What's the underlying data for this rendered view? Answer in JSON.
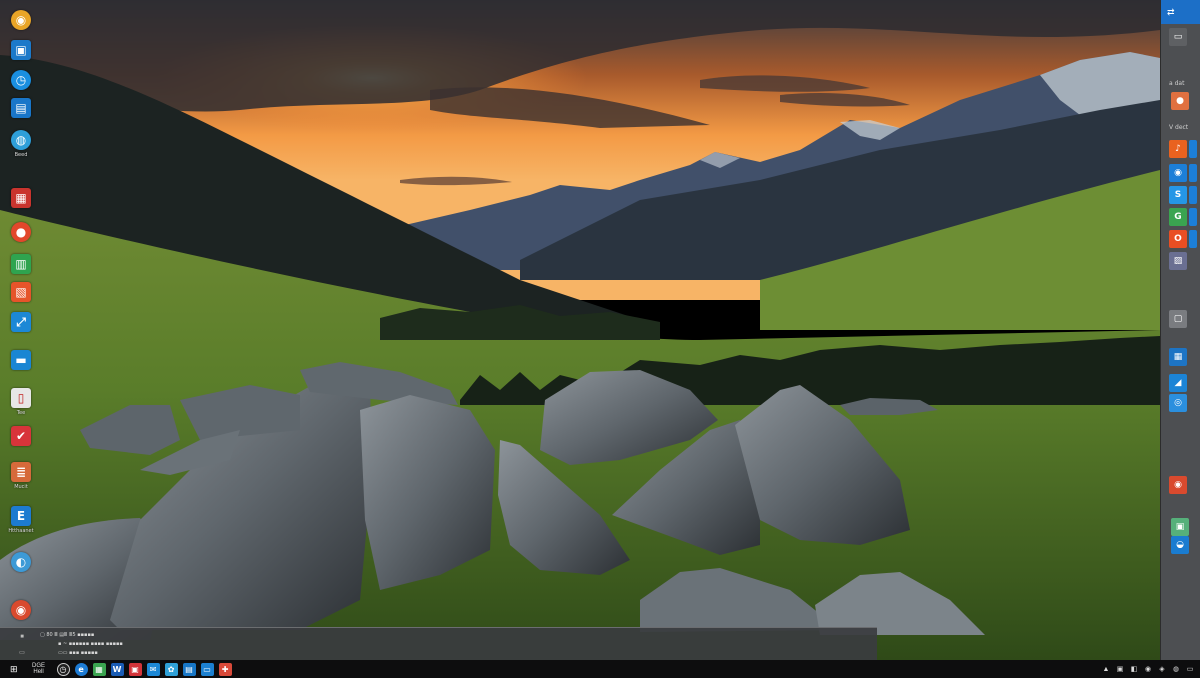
{
  "desktop_icons": [
    {
      "name": "chrome-icon",
      "glyph": "◉",
      "color": "#e9a527",
      "round": true,
      "label": ""
    },
    {
      "name": "app-blue-icon",
      "glyph": "▣",
      "color": "#1c79c9",
      "round": false,
      "label": ""
    },
    {
      "name": "clock-icon",
      "glyph": "◷",
      "color": "#1a8fe0",
      "round": true,
      "label": ""
    },
    {
      "name": "app-square-icon",
      "glyph": "▤",
      "color": "#1976c9",
      "round": false,
      "label": ""
    },
    {
      "name": "browser-icon",
      "glyph": "◍",
      "color": "#2e9fd9",
      "round": true,
      "label": "Beed"
    },
    {
      "name": "red-app-icon",
      "glyph": "▦",
      "color": "#c9342e",
      "round": false,
      "label": ""
    },
    {
      "name": "red-circle-icon",
      "glyph": "●",
      "color": "#e2472b",
      "round": true,
      "label": ""
    },
    {
      "name": "green-doc-icon",
      "glyph": "▥",
      "color": "#2fa44f",
      "round": false,
      "label": ""
    },
    {
      "name": "orange-app-icon",
      "glyph": "▧",
      "color": "#e6542a",
      "round": false,
      "label": ""
    },
    {
      "name": "remote-icon",
      "glyph": "⤢",
      "color": "#1c88d6",
      "round": false,
      "label": ""
    },
    {
      "name": "mail-icon",
      "glyph": "▬",
      "color": "#1a86d3",
      "round": false,
      "label": ""
    },
    {
      "name": "document-icon",
      "glyph": "▯",
      "color": "#e7e7e7",
      "round": false,
      "label": "Tee"
    },
    {
      "name": "check-icon",
      "glyph": "✔",
      "color": "#d8343a",
      "round": false,
      "label": ""
    },
    {
      "name": "stack-icon",
      "glyph": "≣",
      "color": "#d66a3b",
      "round": false,
      "label": "Mucit"
    },
    {
      "name": "text-app-icon",
      "glyph": "E",
      "color": "#1d7bd0",
      "round": false,
      "label": "Htthaanet"
    },
    {
      "name": "globe-icon",
      "glyph": "◐",
      "color": "#3d9ad6",
      "round": true,
      "label": ""
    },
    {
      "name": "chrome-bottom-icon",
      "glyph": "◉",
      "color": "#d94a2e",
      "round": true,
      "label": ""
    }
  ],
  "side_panel": {
    "header_glyph": "⇄",
    "items": [
      {
        "name": "panel-chat-icon",
        "glyph": "▭",
        "color": "#5e6063"
      },
      {
        "name": "panel-text-1",
        "text": "a dat"
      },
      {
        "name": "panel-avatar-icon",
        "glyph": "●",
        "color": "#e07040"
      },
      {
        "name": "panel-text-2",
        "text": "V dect"
      },
      {
        "name": "panel-tile-orange",
        "glyph": "♪",
        "color": "#e9621f"
      },
      {
        "name": "panel-tile-blue-1",
        "glyph": "◉",
        "color": "#1c7fd8"
      },
      {
        "name": "panel-tile-skype",
        "glyph": "S",
        "color": "#2596e6"
      },
      {
        "name": "panel-tile-green",
        "glyph": "G",
        "color": "#3aa450"
      },
      {
        "name": "panel-tile-office",
        "glyph": "O",
        "color": "#e94e23"
      },
      {
        "name": "panel-tile-photo",
        "glyph": "▨",
        "color": "#6a6f92"
      },
      {
        "name": "panel-tile-grey",
        "glyph": "▢",
        "color": "#7a7c80"
      },
      {
        "name": "panel-tile-blue-2",
        "glyph": "▦",
        "color": "#1d74c4"
      },
      {
        "name": "panel-tile-blue-3",
        "glyph": "◢",
        "color": "#1c84d6"
      },
      {
        "name": "panel-tile-blue-4",
        "glyph": "◎",
        "color": "#2b8fde"
      },
      {
        "name": "panel-tile-chrome",
        "glyph": "◉",
        "color": "#d94a2e"
      },
      {
        "name": "panel-tile-mint",
        "glyph": "▣",
        "color": "#56b07a"
      },
      {
        "name": "panel-tile-blue-5",
        "glyph": "◒",
        "color": "#1a7cd0"
      }
    ]
  },
  "notification": {
    "thumb_top": "■",
    "thumb_bottom": "▭",
    "line1": "▢ 80 Ⅲ ▤Ⅲ Ⅲ5 ▪▪▪▪▪",
    "line2": "▪ ~ ▪▪▪▪▪▪ ▪▪▪▪ ▪▪▪▪▪",
    "line3": "▭▭ ▪▪▪ ▪▪▪▪▪"
  },
  "taskbar": {
    "start_glyph": "⊞",
    "search_label": "DGE Hell",
    "apps": [
      {
        "name": "taskbar-clock-icon",
        "glyph": "◷",
        "color": "#222",
        "round": true
      },
      {
        "name": "taskbar-edge-icon",
        "glyph": "e",
        "color": "#1d7bd4",
        "round": true
      },
      {
        "name": "taskbar-store-icon",
        "glyph": "▦",
        "color": "#3aa450",
        "round": false
      },
      {
        "name": "taskbar-word-icon",
        "glyph": "W",
        "color": "#1a5cb5",
        "round": false
      },
      {
        "name": "taskbar-red-icon",
        "glyph": "▣",
        "color": "#d3343a",
        "round": false
      },
      {
        "name": "taskbar-mail-icon",
        "glyph": "✉",
        "color": "#1c88d6",
        "round": false
      },
      {
        "name": "taskbar-photos-icon",
        "glyph": "✿",
        "color": "#2fa1d8",
        "round": false
      },
      {
        "name": "taskbar-app-icon",
        "glyph": "▤",
        "color": "#1776c6",
        "round": false
      },
      {
        "name": "taskbar-explorer-icon",
        "glyph": "▭",
        "color": "#1c80d0",
        "round": false
      },
      {
        "name": "taskbar-tool-icon",
        "glyph": "✚",
        "color": "#d84a3a",
        "round": false
      }
    ],
    "tray": [
      "▲",
      "▣",
      "◧",
      "◉",
      "◈",
      "◍",
      "▭"
    ]
  }
}
